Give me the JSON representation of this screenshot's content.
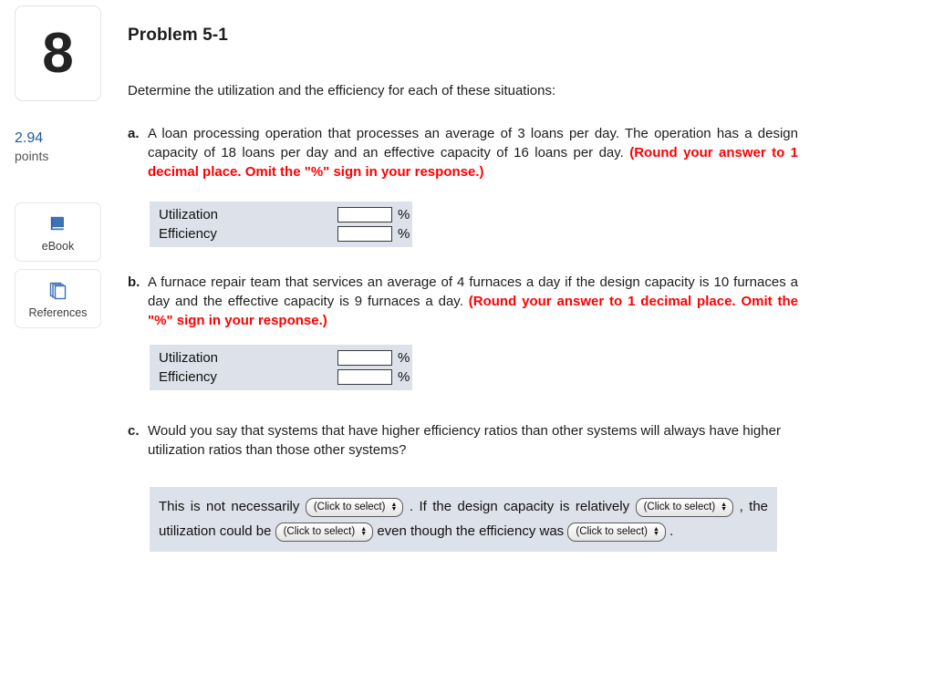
{
  "question": {
    "number": "8",
    "points_value": "2.94",
    "points_label": "points"
  },
  "tools": [
    {
      "icon": "ebook-icon",
      "label": "eBook"
    },
    {
      "icon": "references-icon",
      "label": "References"
    }
  ],
  "header": {
    "title": "Problem 5-1",
    "intro": "Determine the utilization and the efficiency for each of these situations:"
  },
  "parts": [
    {
      "letter": "a.",
      "text": "A loan processing operation that processes an average of 3 loans per day. The operation has a design capacity of 18 loans per day and an effective capacity of 16 loans per day. ",
      "instruction": "(Round your answer to 1 decimal place. Omit the \"%\" sign in your response.)"
    },
    {
      "letter": "b.",
      "text": "A furnace repair team that services an average of 4 furnaces a day if the design capacity is 10 furnaces a day and the effective capacity is 9 furnaces a day. ",
      "instruction": "(Round your answer to 1 decimal place. Omit the \"%\" sign in your response.)"
    },
    {
      "letter": "c.",
      "text": "Would you say that systems that have higher efficiency ratios than other systems will always have higher utilization ratios than those other systems?",
      "instruction": ""
    }
  ],
  "answer_tables": [
    {
      "rows": [
        {
          "label": "Utilization",
          "value": "",
          "unit": "%"
        },
        {
          "label": "Efficiency",
          "value": "",
          "unit": "%"
        }
      ]
    },
    {
      "rows": [
        {
          "label": "Utilization",
          "value": "",
          "unit": "%"
        },
        {
          "label": "Efficiency",
          "value": "",
          "unit": "%"
        }
      ]
    }
  ],
  "select_panel": {
    "select_placeholder": "(Click to select)",
    "frag_1": "This is not necessarily",
    "frag_2": ". If the design capacity is relatively",
    "frag_3": ", the utilization could be",
    "frag_4": "even though the",
    "frag_5": "efficiency was",
    "frag_6": "."
  },
  "colors": {
    "table_bg": "#dde1e9",
    "points_blue": "#1b5c9e",
    "instruction_red": "#ff0000",
    "icon_blue": "#3d72b4"
  }
}
